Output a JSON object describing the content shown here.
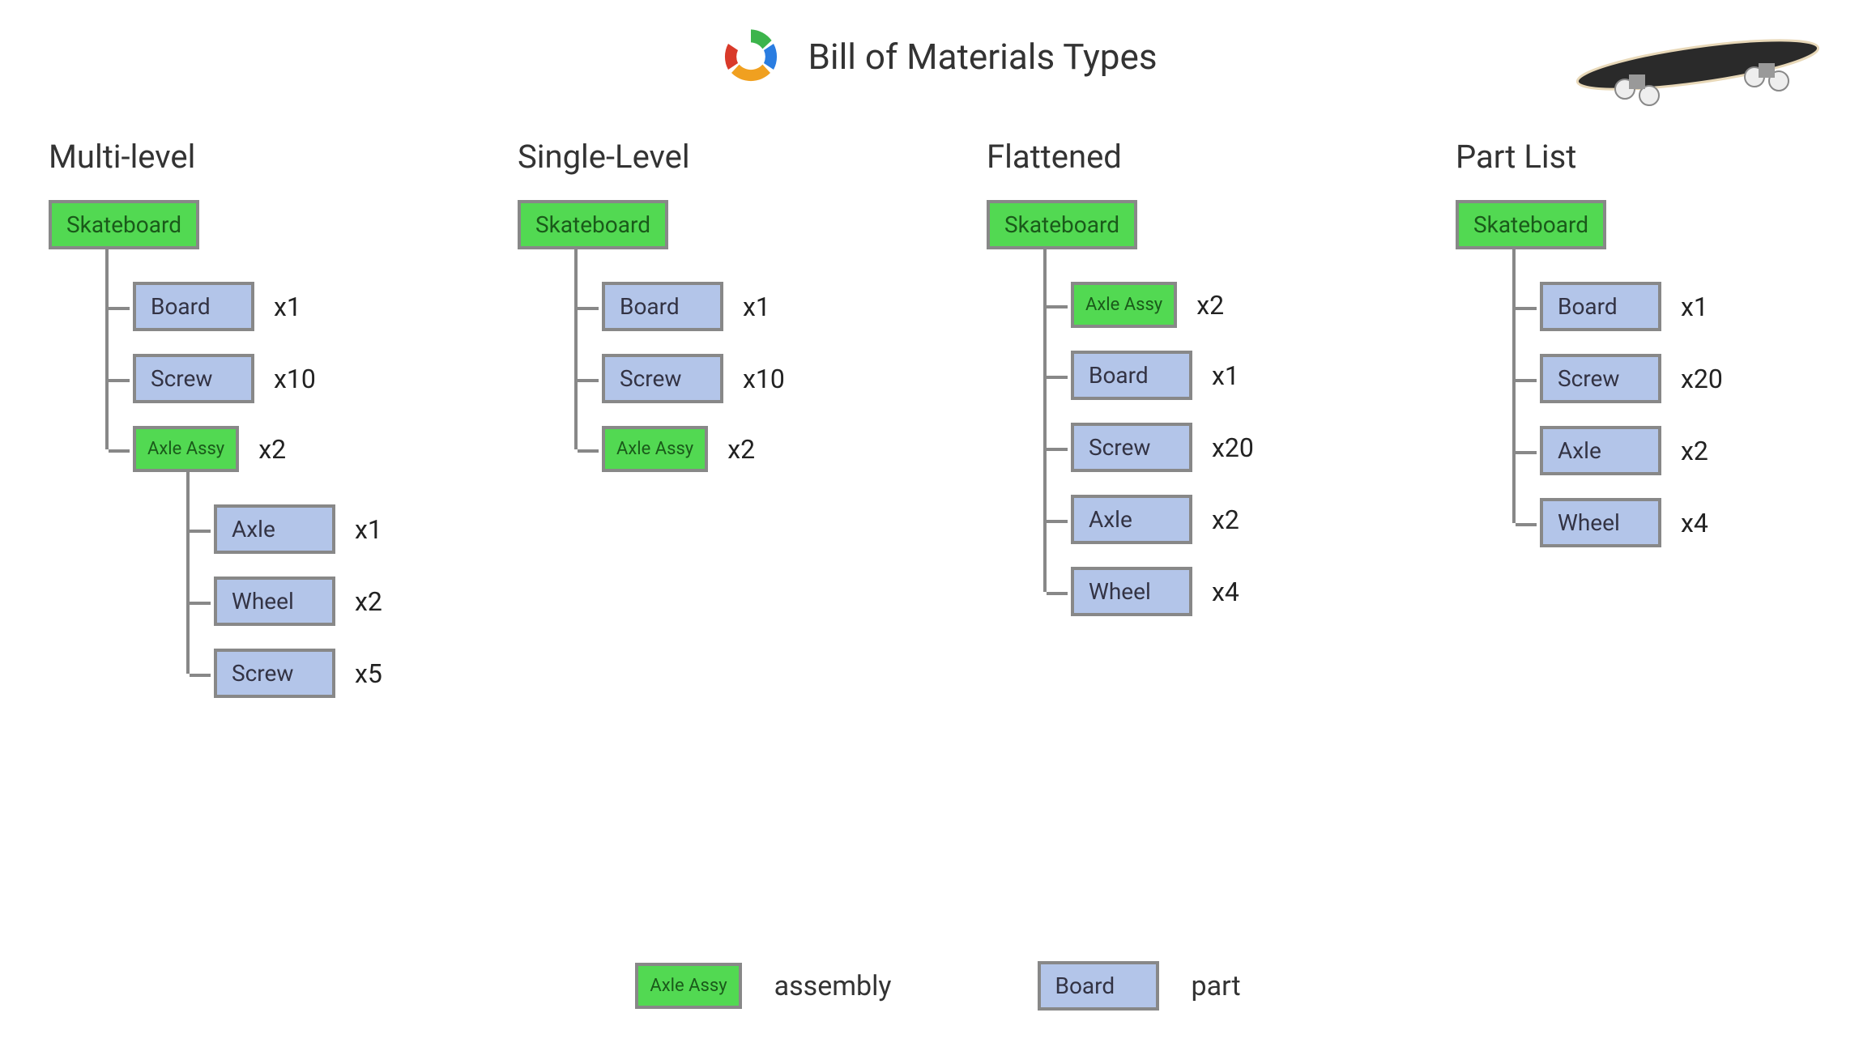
{
  "title": "Bill of Materials Types",
  "colors": {
    "assembly": "#52d952",
    "part": "#b3c5e9",
    "border": "#888888"
  },
  "columns": [
    {
      "title": "Multi-level",
      "root": {
        "label": "Skateboard",
        "type": "assembly"
      },
      "children": [
        {
          "label": "Board",
          "type": "part",
          "qty": "x1"
        },
        {
          "label": "Screw",
          "type": "part",
          "qty": "x10"
        },
        {
          "label": "Axle Assy",
          "type": "assembly",
          "qty": "x2",
          "children": [
            {
              "label": "Axle",
              "type": "part",
              "qty": "x1"
            },
            {
              "label": "Wheel",
              "type": "part",
              "qty": "x2"
            },
            {
              "label": "Screw",
              "type": "part",
              "qty": "x5"
            }
          ]
        }
      ]
    },
    {
      "title": "Single-Level",
      "root": {
        "label": "Skateboard",
        "type": "assembly"
      },
      "children": [
        {
          "label": "Board",
          "type": "part",
          "qty": "x1"
        },
        {
          "label": "Screw",
          "type": "part",
          "qty": "x10"
        },
        {
          "label": "Axle Assy",
          "type": "assembly",
          "qty": "x2"
        }
      ]
    },
    {
      "title": "Flattened",
      "root": {
        "label": "Skateboard",
        "type": "assembly"
      },
      "children": [
        {
          "label": "Axle Assy",
          "type": "assembly",
          "qty": "x2"
        },
        {
          "label": "Board",
          "type": "part",
          "qty": "x1"
        },
        {
          "label": "Screw",
          "type": "part",
          "qty": "x20"
        },
        {
          "label": "Axle",
          "type": "part",
          "qty": "x2"
        },
        {
          "label": "Wheel",
          "type": "part",
          "qty": "x4"
        }
      ]
    },
    {
      "title": "Part List",
      "root": {
        "label": "Skateboard",
        "type": "assembly"
      },
      "children": [
        {
          "label": "Board",
          "type": "part",
          "qty": "x1"
        },
        {
          "label": "Screw",
          "type": "part",
          "qty": "x20"
        },
        {
          "label": "Axle",
          "type": "part",
          "qty": "x2"
        },
        {
          "label": "Wheel",
          "type": "part",
          "qty": "x4"
        }
      ]
    }
  ],
  "legend": {
    "assembly": {
      "example_label": "Axle Assy",
      "term": "assembly"
    },
    "part": {
      "example_label": "Board",
      "term": "part"
    }
  }
}
